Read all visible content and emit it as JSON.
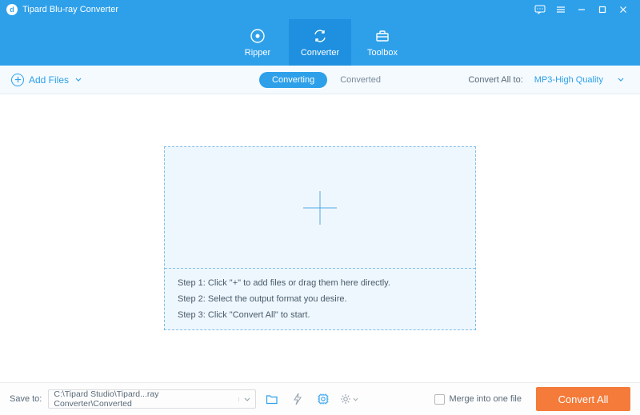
{
  "app": {
    "title": "Tipard Blu-ray Converter"
  },
  "modes": {
    "ripper": "Ripper",
    "converter": "Converter",
    "toolbox": "Toolbox"
  },
  "toolbar": {
    "add_files": "Add Files",
    "tab_converting": "Converting",
    "tab_converted": "Converted",
    "convert_all_to": "Convert All to:",
    "format": "MP3-High Quality"
  },
  "dropzone": {
    "step1": "Step 1: Click \"+\" to add files or drag them here directly.",
    "step2": "Step 2: Select the output format you desire.",
    "step3": "Step 3: Click \"Convert All\" to start."
  },
  "bottom": {
    "save_to": "Save to:",
    "path": "C:\\Tipard Studio\\Tipard...ray Converter\\Converted",
    "merge": "Merge into one file",
    "convert_all": "Convert All"
  }
}
